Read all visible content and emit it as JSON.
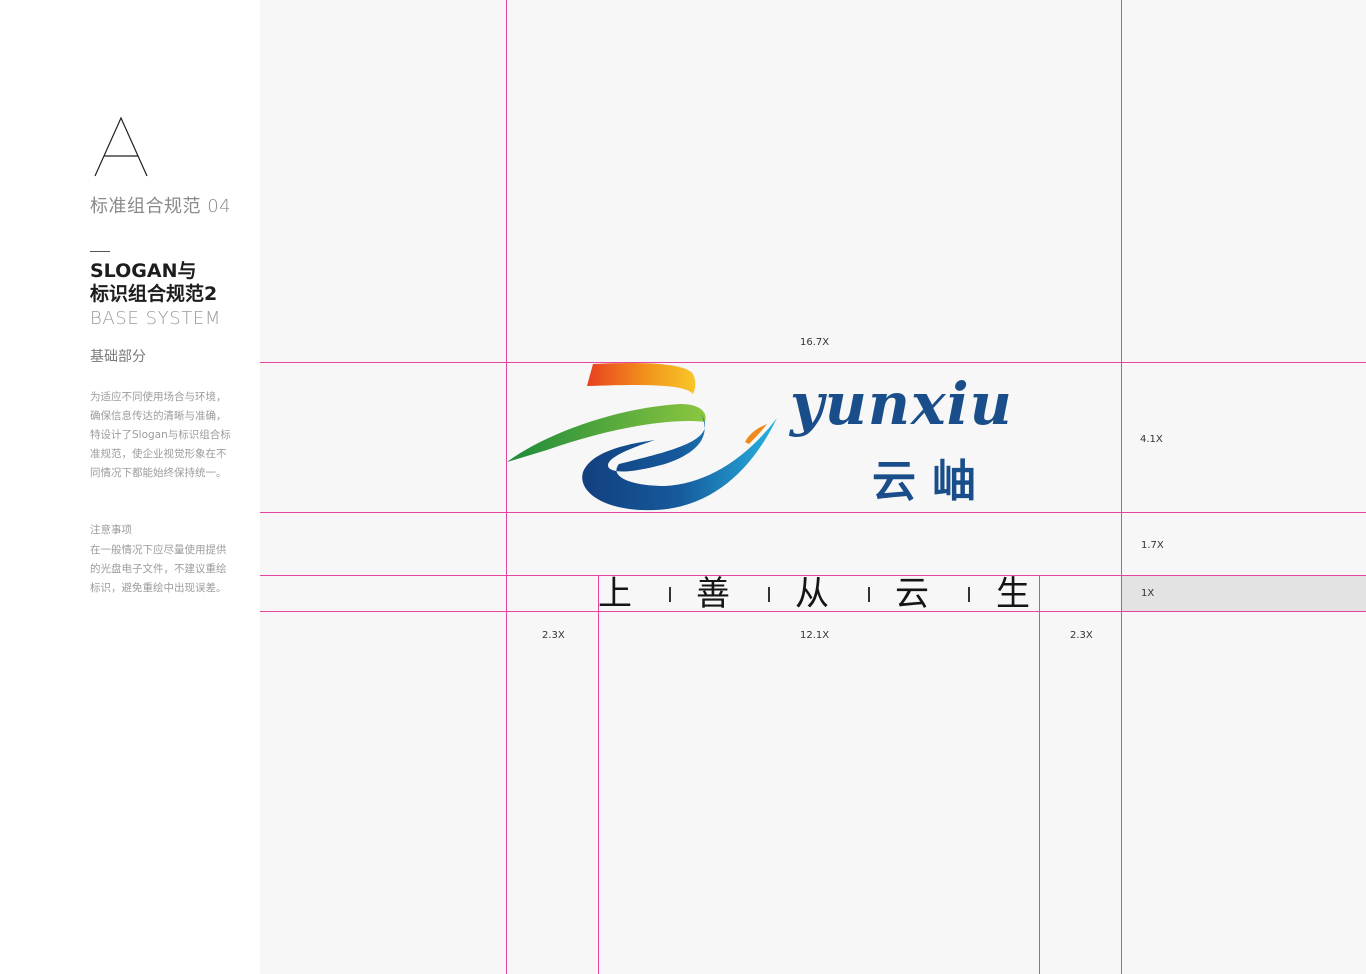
{
  "sidebar": {
    "section_letter": "A",
    "section_title": "标准组合规范 04",
    "heading_line1": "SLOGAN与",
    "heading_line2": "标识组合规范2",
    "subheading": "BASE SYSTEM",
    "part_label": "基础部分",
    "description": "为适应不同使用场合与环境，确保信息传达的清晰与准确，特设计了Slogan与标识组合标准规范，使企业视觉形象在不同情况下都能始终保持统一。",
    "note_title": "注意事项",
    "note_body": "在一般情况下应尽量使用提供的光盘电子文件，不建议重绘标识，避免重绘中出现误差。"
  },
  "logo": {
    "latin_name": "yunxiu",
    "chinese_name": "云岫",
    "colors": {
      "blue": "#1a4e8a",
      "green": "#2e9a3e",
      "orange": "#f08a1c",
      "cyan": "#1aa0d8"
    }
  },
  "slogan": {
    "chars": [
      "上",
      "善",
      "从",
      "云",
      "生"
    ]
  },
  "dimensions": {
    "top_width": "16.7X",
    "logo_height": "4.1X",
    "gap_height": "1.7X",
    "slogan_height": "1X",
    "left_margin": "2.3X",
    "slogan_width": "12.1X",
    "right_margin": "2.3X"
  },
  "guide_color": "#e5459f"
}
